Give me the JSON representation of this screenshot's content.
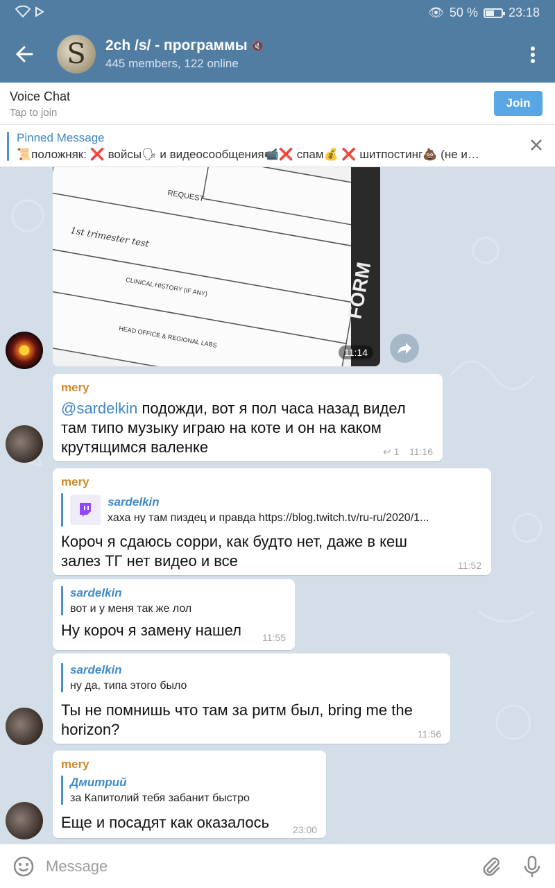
{
  "status_bar": {
    "battery": "50 %",
    "time": "23:18"
  },
  "header": {
    "avatar_letter": "S",
    "title": "2ch /s/ - программы",
    "subtitle": "445 members, 122 online",
    "mute_glyph": "🔇"
  },
  "voice_chat": {
    "title": "Voice Chat",
    "subtitle": "Tap to join",
    "join_label": "Join"
  },
  "pinned": {
    "title": "Pinned Message",
    "text": "📜положняк: ❌ войсы🗣 и видеосообщения📹❌ спам💰 ❌ шитпостинг💩 (не и…"
  },
  "photo": {
    "time": "11:14",
    "doc_text": [
      "REQUEST",
      "1st trimester test",
      "CLINICAL HISTORY (IF ANY)",
      "HEAD OFFICE & REGIONAL LABS",
      "FORM"
    ]
  },
  "messages": [
    {
      "sender": "mery",
      "mention": "@sardelkin",
      "lines": [
        "подожди, вот я пол часа назад видел",
        "там типо музыку играю на коте и он на каком",
        "крутящимся валенке"
      ],
      "replies": "1",
      "time": "11:16"
    },
    {
      "sender": "mery",
      "link_name": "sardelkin",
      "link_text": "хаха ну там пиздец и правда https://blog.twitch.tv/ru-ru/2020/1...",
      "lines": [
        "Короч я сдаюсь сорри, как будто нет, даже в кеш",
        "залез ТГ нет видео и все"
      ],
      "time": "11:52"
    },
    {
      "reply_name": "sardelkin",
      "reply_text": "вот и у меня так же лол",
      "lines": [
        "Ну короч я замену нашел"
      ],
      "time": "11:55"
    },
    {
      "reply_name": "sardelkin",
      "reply_text": "ну да, типа этого было",
      "lines": [
        "Ты не помнишь что там за ритм был, bring me the",
        "horizon?"
      ],
      "time": "11:56"
    },
    {
      "sender": "mery",
      "reply_name": "Дмитрий",
      "reply_text": "за Капитолий тебя забанит быстро",
      "lines": [
        "Еще и посадят как оказалось"
      ],
      "time": "23:00"
    }
  ],
  "input": {
    "placeholder": "Message"
  },
  "colors": {
    "header": "#527da3",
    "accent": "#4a90d0",
    "sender": "#d08a2e",
    "chat_bg": "#d4dee8"
  }
}
